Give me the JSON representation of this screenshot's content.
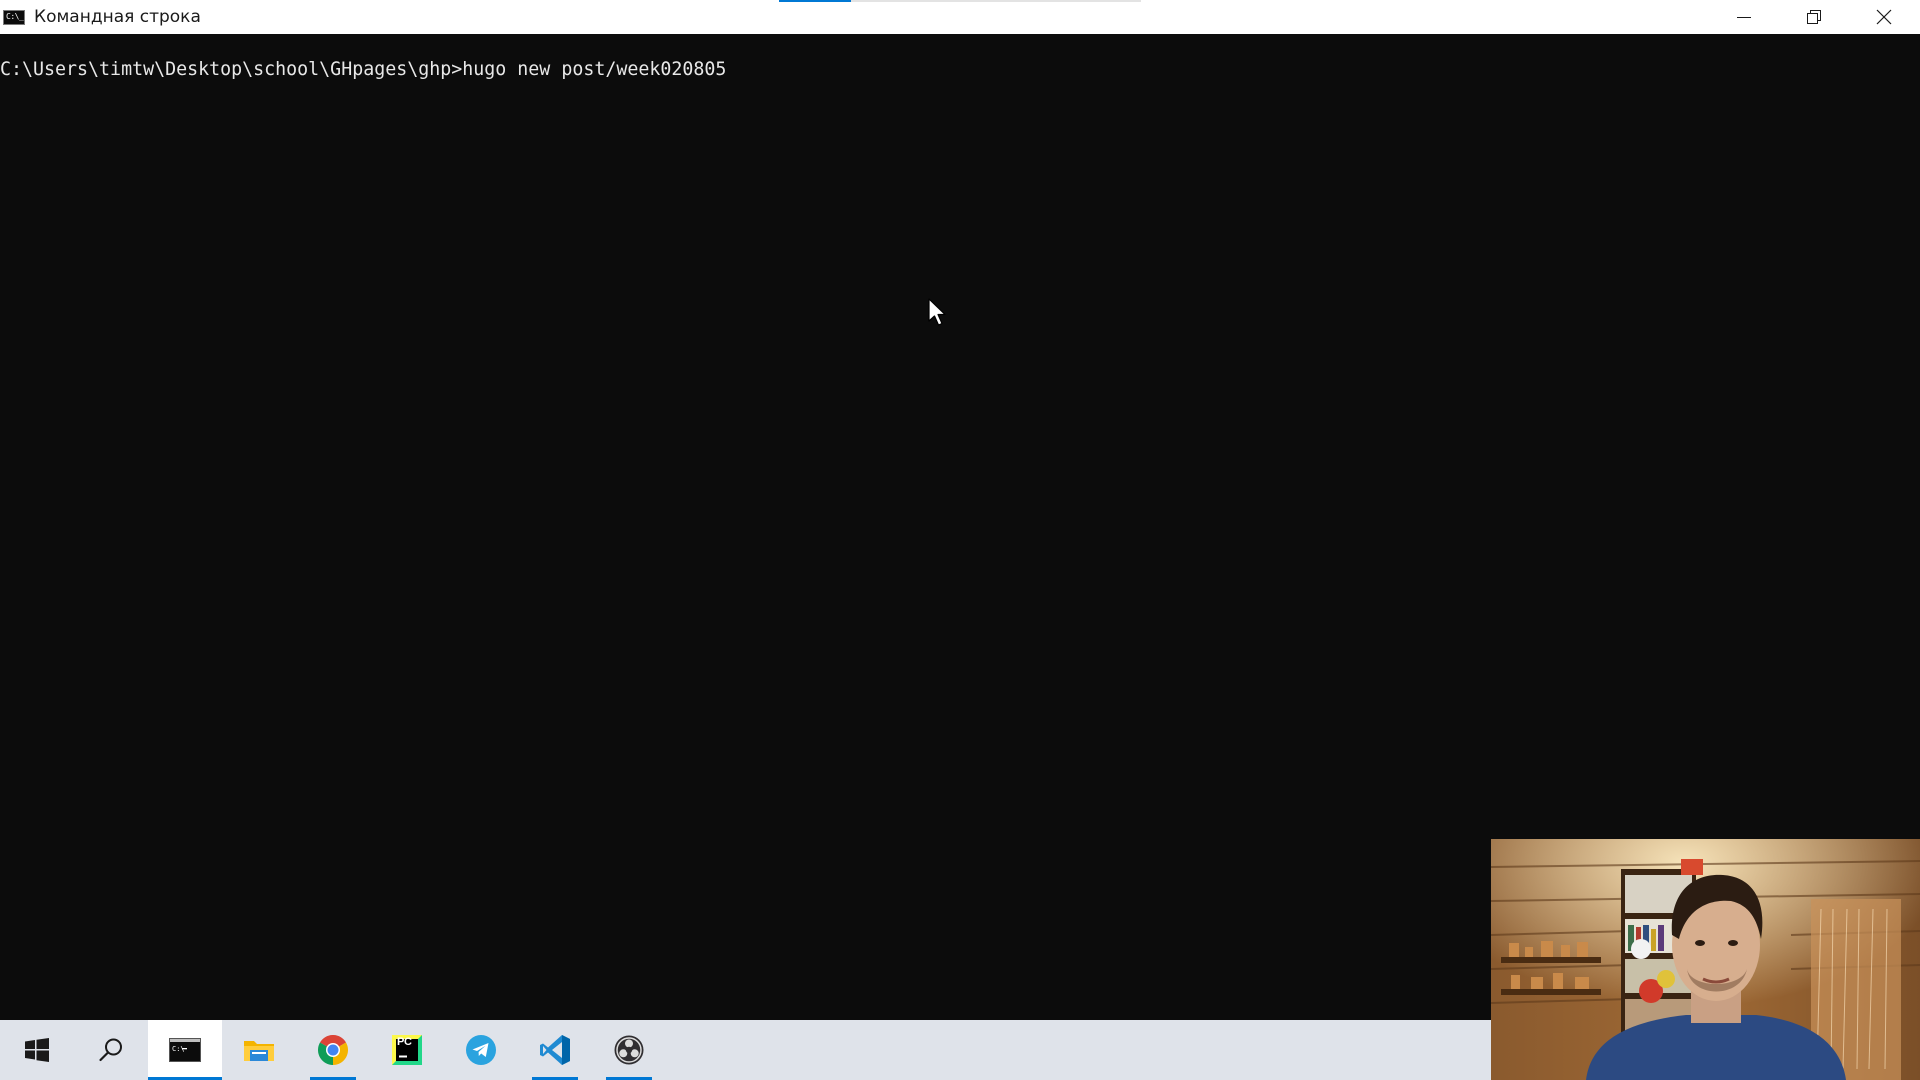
{
  "window": {
    "title": "Командная строка",
    "icon": "cmd-icon",
    "icon_glyph": "C:\\_",
    "controls": [
      "minimize-icon",
      "restore-icon",
      "close-icon"
    ]
  },
  "console": {
    "prompt": "C:\\Users\\timtw\\Desktop\\school\\GHpages\\ghp>",
    "command": "hugo new post/week020805",
    "text_color": "#e8e8e8",
    "background": "#0c0c0c"
  },
  "taskbar": {
    "items": [
      {
        "name": "start",
        "icon": "windows-logo-icon",
        "running": false,
        "active": false
      },
      {
        "name": "search",
        "icon": "search-icon",
        "running": false,
        "active": false
      },
      {
        "name": "command-prompt",
        "icon": "terminal-icon",
        "running": true,
        "active": true
      },
      {
        "name": "file-explorer",
        "icon": "folder-icon",
        "running": false,
        "active": false
      },
      {
        "name": "chrome",
        "icon": "chrome-icon",
        "running": true,
        "active": false
      },
      {
        "name": "pycharm",
        "icon": "pycharm-icon",
        "running": false,
        "active": false
      },
      {
        "name": "telegram",
        "icon": "telegram-icon",
        "running": false,
        "active": false
      },
      {
        "name": "vscode",
        "icon": "vscode-icon",
        "running": true,
        "active": false
      },
      {
        "name": "obs-studio",
        "icon": "obs-icon",
        "running": true,
        "active": false
      }
    ],
    "pycharm_badge": "PC",
    "accent": "#0078d4",
    "background": "#dfe3ea"
  },
  "webcam": {
    "content": "presenter-webcam-feed"
  }
}
